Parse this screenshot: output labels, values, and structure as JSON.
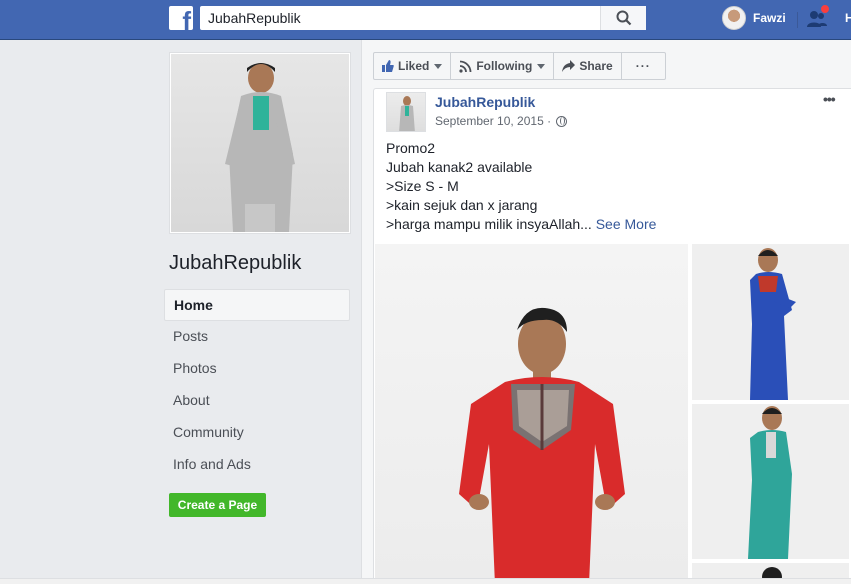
{
  "topbar": {
    "logo": "f",
    "search_value": "JubahRepublik",
    "user_name": "Fawzi",
    "home_letter": "H",
    "brand_color": "#4267b2"
  },
  "sidebar": {
    "page_name": "JubahRepublik",
    "nav": [
      {
        "label": "Home",
        "active": true
      },
      {
        "label": "Posts"
      },
      {
        "label": "Photos"
      },
      {
        "label": "About"
      },
      {
        "label": "Community"
      },
      {
        "label": "Info and Ads"
      }
    ],
    "create_page_label": "Create a Page"
  },
  "actions": {
    "liked": "Liked",
    "following": "Following",
    "share": "Share",
    "more": "···"
  },
  "post": {
    "page_name": "JubahRepublik",
    "date": "September 10, 2015 ·",
    "more": "•••",
    "lines": [
      "Promo2",
      "Jubah kanak2 available",
      ">Size S - M",
      ">kain sejuk dan x jarang",
      ">harga mampu milik insyaAllah..."
    ],
    "see_more": "See More"
  },
  "photos": {
    "main_robe_color": "#d92b2b",
    "side_robe_colors": [
      "#2a4fb8",
      "#2fa59a"
    ]
  }
}
